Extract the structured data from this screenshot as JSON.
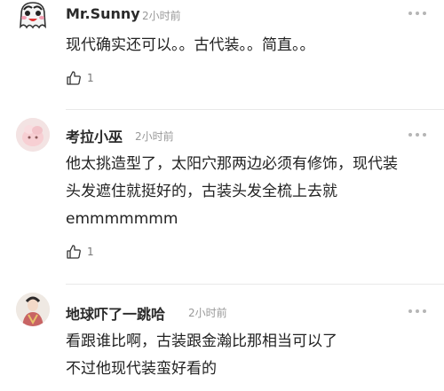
{
  "comments": [
    {
      "username": "Mr.Sunny",
      "time": "2小时前",
      "lines": [
        "现代确实还可以。。古代装。。简直。。"
      ],
      "likes": "1",
      "avatar_icon": "cartoon-ghost-avatar"
    },
    {
      "username": "考拉小巫",
      "time": "2小时前",
      "lines": [
        "他太挑造型了，太阳穴那两边必须有修饰，现代装",
        "头发遮住就挺好的，古装头发全梳上去就",
        "emmmmmmm"
      ],
      "likes": "1",
      "avatar_icon": "pink-blob-avatar"
    },
    {
      "username": "地球吓了一跳哈",
      "time": "2小时前",
      "lines": [
        "看跟谁比啊，古装跟金瀚比那相当可以了",
        "不过他现代装蛮好看的"
      ],
      "avatar_icon": "costume-figure-avatar"
    }
  ],
  "icons": {
    "like": "thumbs-up-icon",
    "more": "more-dots-icon"
  }
}
